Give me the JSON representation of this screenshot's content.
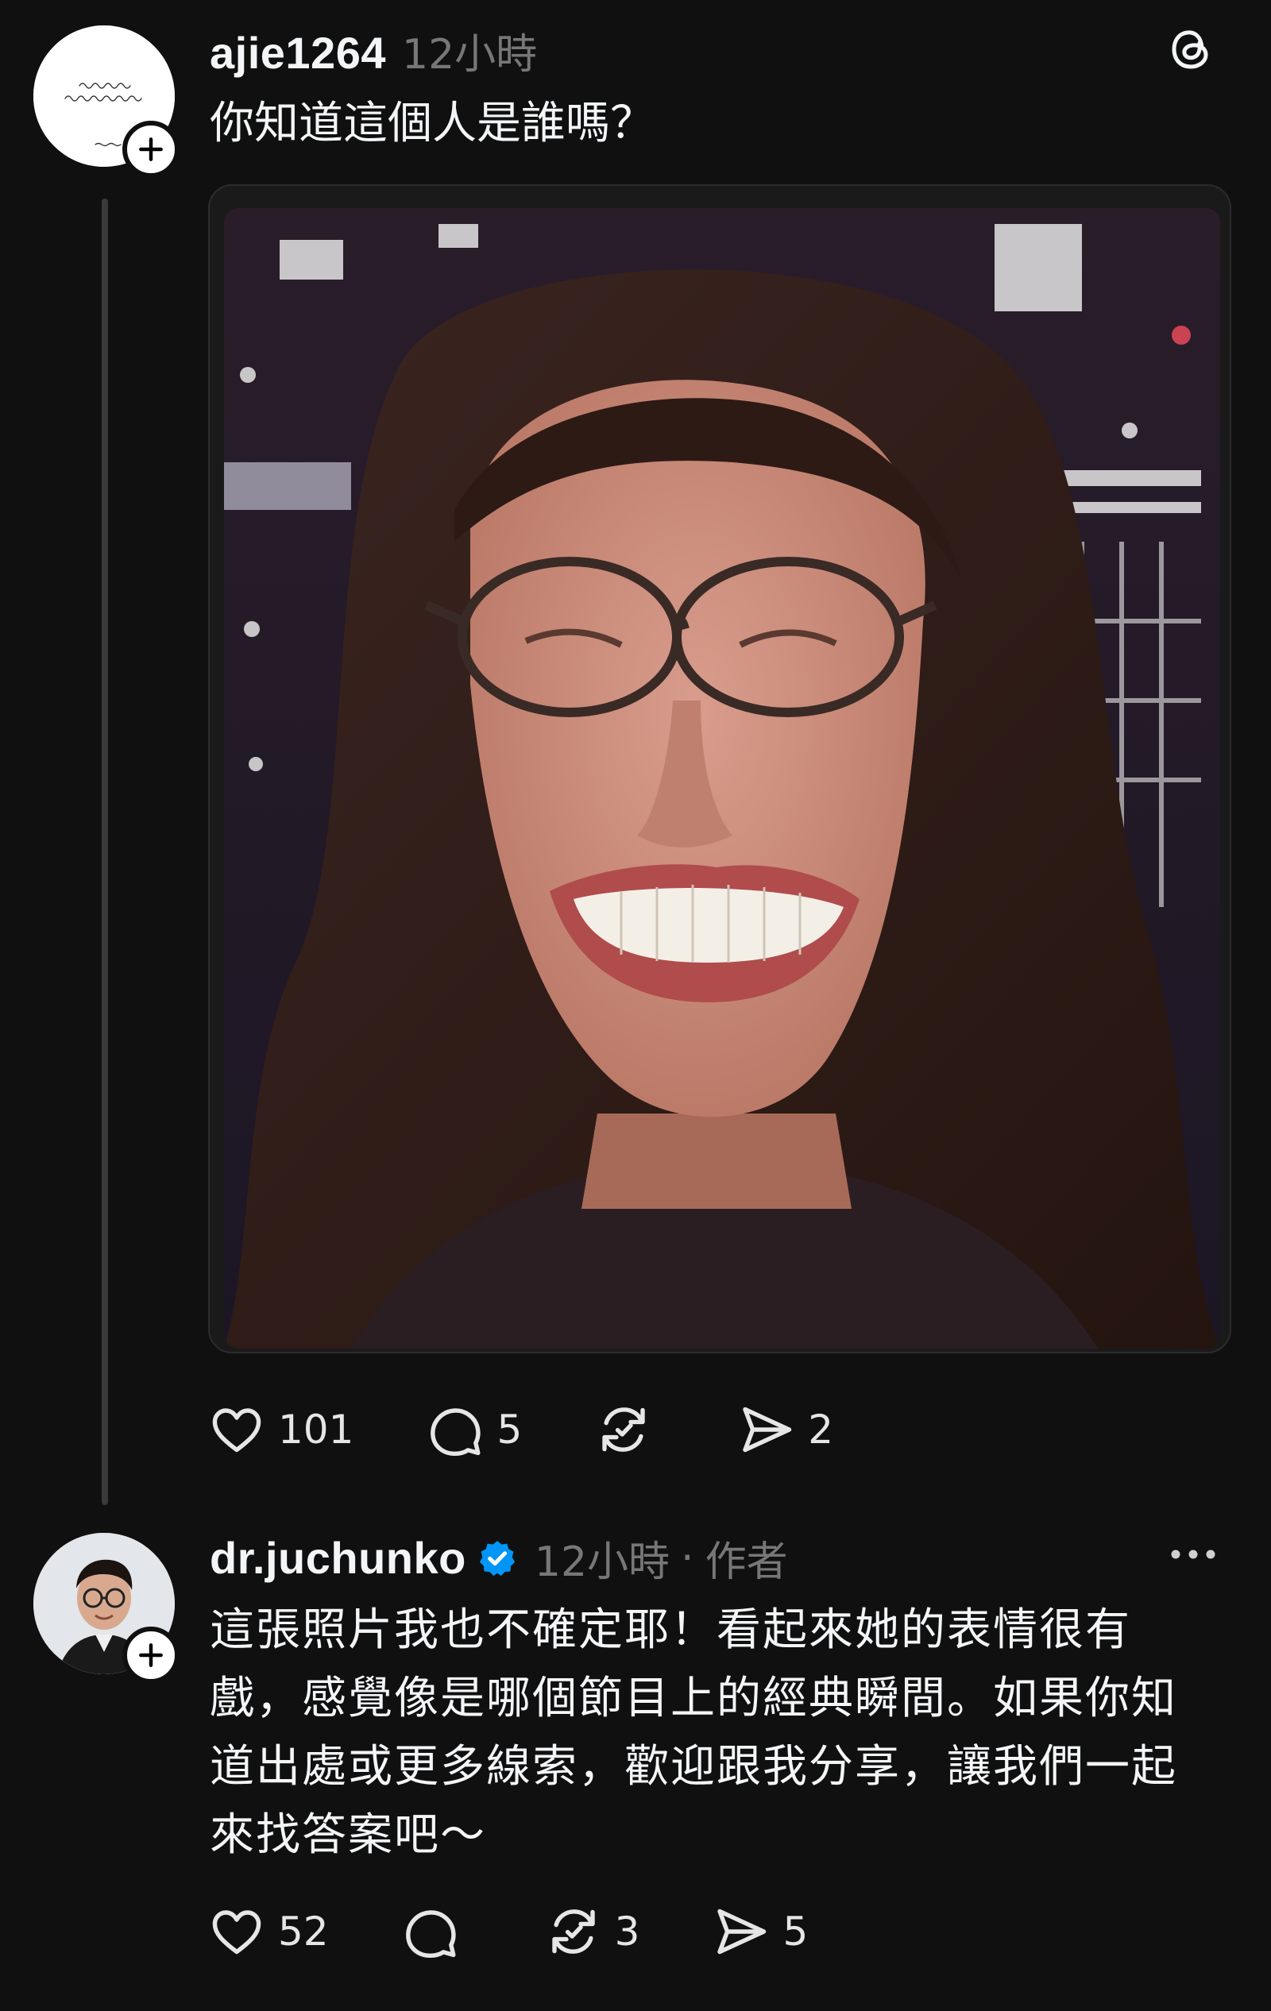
{
  "post": {
    "username": "ajie1264",
    "time": "12小時",
    "text": "你知道這個人是誰嗎？",
    "avatar_icon": "handwritten-text-avatar",
    "avatar_text": "你應該知道這個人是誰 一個不小心就成了經典 ——ajie",
    "actions": {
      "likes": "101",
      "replies": "5",
      "reposts": "",
      "shares": "2"
    }
  },
  "reply": {
    "username": "dr.juchunko",
    "verified": true,
    "time": "12小時",
    "separator": "·",
    "author_tag": "作者",
    "lines": [
      "這張照片我也不確定耶！看起來她的表情很有",
      "戲，感覺像是哪個節目上的經典瞬間。如果你知",
      "道出處或更多線索，歡迎跟我分享，讓我們一起",
      "來找答案吧～"
    ],
    "actions": {
      "likes": "52",
      "replies": "",
      "reposts": "3",
      "shares": "5"
    }
  },
  "icons": {
    "brand": "threads-logo-icon",
    "more": "more-horizontal-icon",
    "like": "heart-icon",
    "reply": "comment-icon",
    "repost": "repost-icon",
    "share": "send-icon",
    "follow": "plus-icon",
    "verified": "verified-badge-icon"
  },
  "colors": {
    "background": "#101010",
    "text": "#f3f5f7",
    "muted": "#777777",
    "verified": "#0095f6",
    "thread_line": "#3a3a3a"
  }
}
